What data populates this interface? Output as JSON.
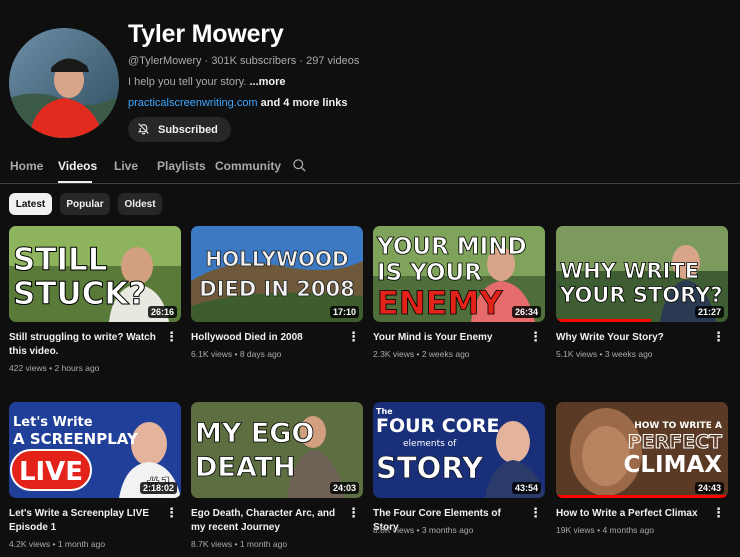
{
  "channel": {
    "name": "Tyler Mowery",
    "handle": "@TylerMowery",
    "subscribers": "301K subscribers",
    "videos": "297 videos",
    "separator": "·",
    "description": "I help you tell your story.",
    "more": "...more",
    "link": "practicalscreenwriting.com",
    "more_links": "and 4 more links",
    "subscribe_label": "Subscribed"
  },
  "tabs": [
    {
      "label": "Home"
    },
    {
      "label": "Videos"
    },
    {
      "label": "Live"
    },
    {
      "label": "Playlists"
    },
    {
      "label": "Community"
    }
  ],
  "filters": [
    {
      "label": "Latest"
    },
    {
      "label": "Popular"
    },
    {
      "label": "Oldest"
    }
  ],
  "videos": [
    {
      "title": "Still struggling to write? Watch this video.",
      "views": "422 views",
      "age": "2 hours ago",
      "duration": "26:16",
      "thumb_text": [
        "STILL",
        "STUCK?"
      ]
    },
    {
      "title": "Hollywood Died in 2008",
      "views": "6.1K views",
      "age": "8 days ago",
      "duration": "17:10",
      "thumb_text": [
        "HOLLYWOOD",
        "DIED IN 2008"
      ]
    },
    {
      "title": "Your Mind is Your Enemy",
      "views": "2.3K views",
      "age": "2 weeks ago",
      "duration": "26:34",
      "thumb_text": [
        "YOUR MIND",
        "IS YOUR",
        "ENEMY"
      ]
    },
    {
      "title": "Why Write Your Story?",
      "views": "5.1K views",
      "age": "3 weeks ago",
      "duration": "21:27",
      "progress": 0.55,
      "thumb_text": [
        "WHY WRITE",
        "YOUR STORY?"
      ]
    },
    {
      "title": "Let's Write a Screenplay LIVE Episode 1",
      "views": "4.2K views",
      "age": "1 month ago",
      "duration": "2:18:02",
      "thumb_text": [
        "Let's Write",
        "A SCREENPLAY",
        "LIVE",
        "#1"
      ]
    },
    {
      "title": "Ego Death, Character Arc, and my recent Journey",
      "views": "8.7K views",
      "age": "1 month ago",
      "duration": "24:03",
      "thumb_text": [
        "MY EGO",
        "DEATH"
      ]
    },
    {
      "title": "The Four Core Elements of Story",
      "views": "8.8K views",
      "age": "3 months ago",
      "duration": "43:54",
      "thumb_text": [
        "The",
        "FOUR CORE",
        "elements of",
        "STORY"
      ]
    },
    {
      "title": "How to Write a Perfect Climax",
      "views": "19K views",
      "age": "4 months ago",
      "duration": "24:43",
      "progress": 1.0,
      "thumb_text": [
        "HOW TO WRITE A",
        "PERFECT",
        "CLIMAX"
      ]
    }
  ],
  "colors": {
    "background": "#0f0f0f",
    "link": "#3ea6ff",
    "progress": "#ff0000",
    "chip": "#272727"
  },
  "icons": {
    "subscribe": "bell-slash-icon",
    "search": "search-icon",
    "more": "more-vert-icon"
  }
}
